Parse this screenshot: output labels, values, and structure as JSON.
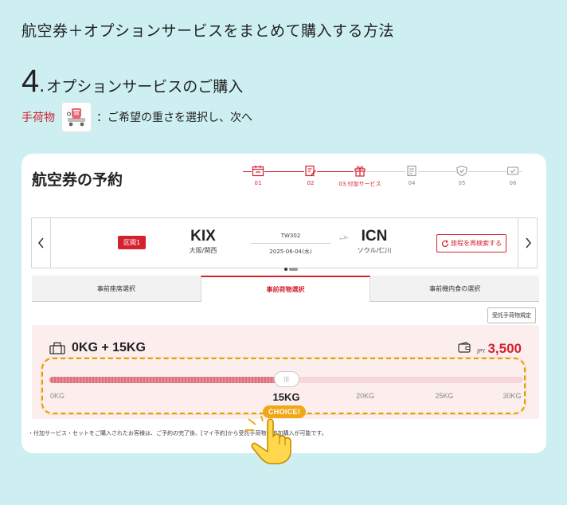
{
  "page": {
    "title": "航空券＋オプションサービスをまとめて購入する方法",
    "step_number": "4",
    "step_dot": ".",
    "step_title": "オプションサービスのご購入",
    "instruction_label": "手荷物",
    "instruction_text": "：ご希望の重さを選択し、次へ"
  },
  "card": {
    "title": "航空券の予約",
    "stepper": [
      {
        "label": "01",
        "icon": "calendar-icon",
        "state": "done"
      },
      {
        "label": "02",
        "icon": "edit-document-icon",
        "state": "done"
      },
      {
        "label": "03.付加サービス",
        "icon": "gift-icon",
        "state": "current"
      },
      {
        "label": "04",
        "icon": "checklist-icon",
        "state": "todo"
      },
      {
        "label": "05",
        "icon": "shield-icon",
        "state": "todo"
      },
      {
        "label": "06",
        "icon": "card-icon",
        "state": "todo"
      }
    ],
    "flight": {
      "segment_badge": "区間1",
      "origin_code": "KIX",
      "origin_name": "大阪/関西",
      "flight_no": "TW302",
      "date": "2025-06-04(水)",
      "destination_code": "ICN",
      "destination_name": "ソウル/仁川",
      "research_label": "旅程を再検索する"
    },
    "tabs": [
      {
        "label": "事前座席選択",
        "active": false
      },
      {
        "label": "事前荷物選択",
        "active": true
      },
      {
        "label": "事前機内食の選択",
        "active": false
      }
    ],
    "rule_button": "受託手荷物規定",
    "baggage": {
      "summary": "0KG + 15KG",
      "currency": "JPY",
      "price": "3,500",
      "slider": {
        "min": 0,
        "max": 30,
        "value": 15,
        "ticks": [
          {
            "value": 0,
            "label": "0KG"
          },
          {
            "value": 15,
            "label": "15KG"
          },
          {
            "value": 20,
            "label": "20KG"
          },
          {
            "value": 25,
            "label": "25KG"
          },
          {
            "value": 30,
            "label": "30KG"
          }
        ]
      }
    },
    "note": "・付加サービス・セットをご購入されたお客様は、ご予約の完了後、[マイ予約]から受託手荷物の追加購入が可能です。"
  },
  "callout": {
    "label": "CHOICE!"
  },
  "colors": {
    "background": "#cdeff2",
    "brand_red": "#d4232f",
    "highlight": "#e2a000",
    "callout": "#f0a817"
  }
}
